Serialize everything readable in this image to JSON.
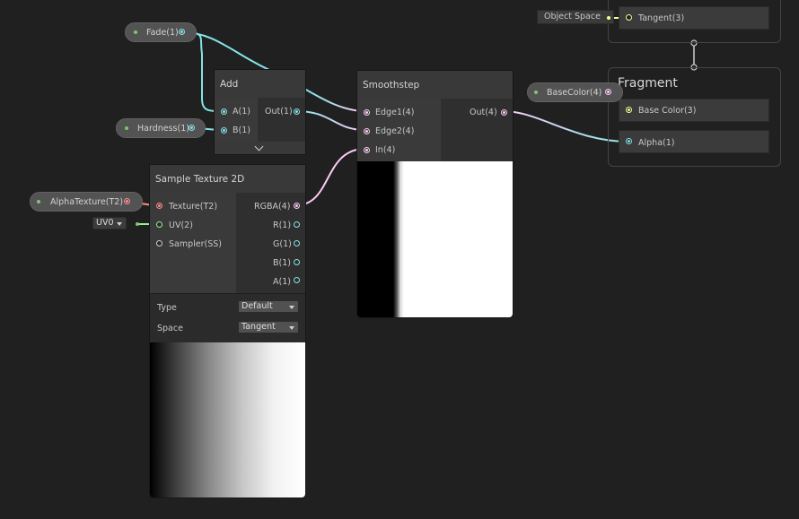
{
  "properties": {
    "fade": "Fade(1)",
    "hardness": "Hardness(1)",
    "alpha_texture": "AlphaTexture(T2)",
    "base_color": "BaseColor(4)"
  },
  "uv_dropdown": {
    "value": "UV0"
  },
  "object_space": {
    "label": "Object Space"
  },
  "add_node": {
    "title": "Add",
    "inputs": [
      "A(1)",
      "B(1)"
    ],
    "output": "Out(1)"
  },
  "smoothstep_node": {
    "title": "Smoothstep",
    "inputs": [
      "Edge1(4)",
      "Edge2(4)",
      "In(4)"
    ],
    "output": "Out(4)"
  },
  "sample_texture_node": {
    "title": "Sample Texture 2D",
    "inputs": [
      "Texture(T2)",
      "UV(2)",
      "Sampler(SS)"
    ],
    "outputs": [
      "RGBA(4)",
      "R(1)",
      "G(1)",
      "B(1)",
      "A(1)"
    ],
    "type_label": "Type",
    "type_value": "Default",
    "space_label": "Space",
    "space_value": "Tangent"
  },
  "vertex_block": {
    "tangent": "Tangent(3)"
  },
  "fragment_block": {
    "title": "Fragment",
    "base_color": "Base Color(3)",
    "alpha": "Alpha(1)"
  },
  "colors": {
    "background": "#202020",
    "float_wire": "#84e4e7",
    "vector4_wire": "#fbcbf4",
    "vector2_wire": "#9aef92",
    "vector3_wire": "#f6ff9a",
    "texture_port": "#ff8b8b",
    "sampler_port": "#cfcfcf"
  }
}
